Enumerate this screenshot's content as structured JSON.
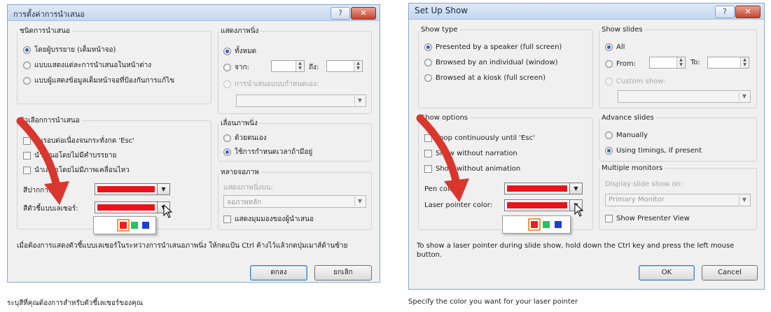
{
  "colors": {
    "accent_red": "#e8141b",
    "swatch_red": "#ee1c24",
    "swatch_green": "#22c55e",
    "swatch_blue": "#1e3ed6",
    "swatch_selected_border": "#f29a3a",
    "arrow_red": "#d9362e"
  },
  "icons": {
    "help": "?",
    "close": "✕",
    "dropdown": "▼",
    "spin_up": "▲",
    "spin_down": "▼",
    "pointer": "mouse-pointer-icon"
  },
  "thai": {
    "title": "การตั้งค่าการนำเสนอ",
    "show_type": {
      "legend": "ชนิดการนำเสนอ",
      "options": [
        "โดยผู้บรรยาย (เต็มหน้าจอ)",
        "แบบแสดงแต่ละการนำเสนอในหน้าต่าง",
        "แบบผู้แสดงข้อมูลเต็มหน้าจอที่ป้องกันการแก้ไข"
      ],
      "selected": 0
    },
    "show_slides": {
      "legend": "แสดงภาพนิ่ง",
      "all": "ทั้งหมด",
      "from": "จาก:",
      "to": "ถึง:",
      "custom": "การนำเสนอแบบกำหนดเอง:"
    },
    "show_options": {
      "legend": "ตัวเลือกการนำเสนอ",
      "items": [
        "วนรอบต่อเนื่องจนกระทั่งกด 'Esc'",
        "นำเสนอโดยไม่มีคำบรรยาย",
        "นำเสนอโดยไม่มีภาพเคลื่อนไหว"
      ],
      "pen_color": "สีปากกา:",
      "laser_color": "สีตัวชี้แบบเลเซอร์:"
    },
    "advance": {
      "legend": "เลื่อนภาพนิ่ง",
      "manual": "ด้วยตนเอง",
      "timings": "ใช้การกำหนดเวลาถ้ามีอยู่"
    },
    "monitors": {
      "legend": "หลายจอภาพ",
      "display_on": "แสดงภาพนิ่งบน:",
      "monitor_value": "จอภาพหลัก",
      "presenter_view": "แสดงมุมมองของผู้นำเสนอ"
    },
    "note": "เมื่อต้องการแสดงตัวชี้แบบเลเซอร์ในระหว่างการนำเสนอภาพนิ่ง ให้กดแป้น Ctrl ค้างไว้แล้วกดปุ่มเมาส์ด้านซ้าย",
    "ok": "ตกลง",
    "cancel": "ยกเลิก",
    "caption": "ระบุสีที่คุณต้องการสำหรับตัวชี้เลเซอร์ของคุณ"
  },
  "english": {
    "title": "Set Up Show",
    "show_type": {
      "legend": "Show type",
      "options": [
        "Presented by a speaker (full screen)",
        "Browsed by an individual (window)",
        "Browsed at a kiosk (full screen)"
      ],
      "selected": 0
    },
    "show_slides": {
      "legend": "Show slides",
      "all": "All",
      "from": "From:",
      "to": "To:",
      "custom": "Custom show:"
    },
    "show_options": {
      "legend": "Show options",
      "items": [
        "Loop continuously until 'Esc'",
        "Show without narration",
        "Show without animation"
      ],
      "pen_color": "Pen color:",
      "laser_color": "Laser pointer color:"
    },
    "advance": {
      "legend": "Advance slides",
      "manual": "Manually",
      "timings": "Using timings, if present"
    },
    "monitors": {
      "legend": "Multiple monitors",
      "display_on": "Display slide show on:",
      "monitor_value": "Primary Monitor",
      "presenter_view": "Show Presenter View"
    },
    "note": "To show a laser pointer during slide show, hold down the Ctrl key and press the left mouse button.",
    "ok": "OK",
    "cancel": "Cancel",
    "caption": "Specify the color you want for your laser pointer"
  }
}
